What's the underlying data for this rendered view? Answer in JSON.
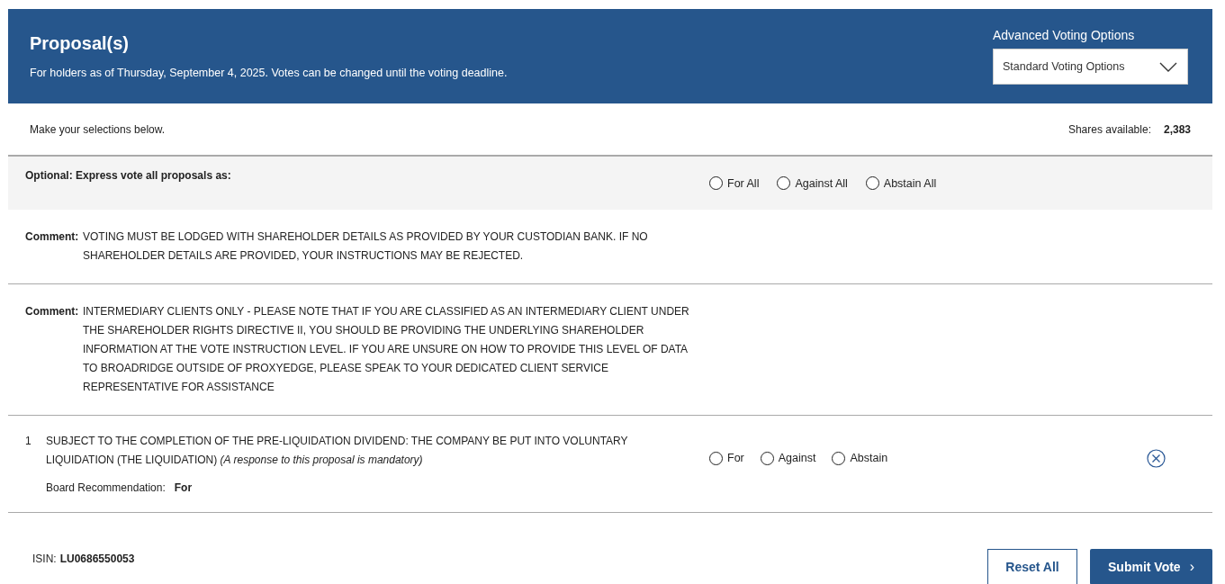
{
  "header": {
    "title": "Proposal(s)",
    "subtitle": "For holders as of Thursday, September 4, 2025. Votes can be changed until the voting deadline.",
    "options_label": "Advanced Voting Options",
    "dropdown": {
      "value": "Standard Voting Options"
    }
  },
  "intro": "Make your selections below.",
  "shares": {
    "label": "Shares available:",
    "value": "2,383"
  },
  "express_vote": {
    "label": "Optional: Express vote all proposals as:",
    "options": [
      {
        "label": "For All",
        "selected": false
      },
      {
        "label": "Against All",
        "selected": false
      },
      {
        "label": "Abstain All",
        "selected": false
      }
    ]
  },
  "comments": [
    {
      "label": "Comment:",
      "text": "VOTING MUST BE LODGED WITH SHAREHOLDER DETAILS AS PROVIDED BY YOUR CUSTODIAN BANK. IF NO SHAREHOLDER DETAILS ARE PROVIDED, YOUR INSTRUCTIONS MAY BE REJECTED."
    },
    {
      "label": "Comment:",
      "text": "INTERMEDIARY CLIENTS ONLY - PLEASE NOTE THAT IF YOU ARE CLASSIFIED AS AN INTERMEDIARY CLIENT UNDER THE SHAREHOLDER RIGHTS DIRECTIVE II, YOU SHOULD BE PROVIDING THE UNDERLYING SHAREHOLDER INFORMATION AT THE VOTE INSTRUCTION LEVEL. IF YOU ARE UNSURE ON HOW TO PROVIDE THIS LEVEL OF DATA TO BROADRIDGE OUTSIDE OF PROXYEDGE, PLEASE SPEAK TO YOUR DEDICATED CLIENT SERVICE REPRESENTATIVE FOR ASSISTANCE"
    }
  ],
  "proposals": [
    {
      "number": "1",
      "text": "SUBJECT TO THE COMPLETION OF THE PRE-LIQUIDATION DIVIDEND: THE COMPANY BE PUT INTO VOLUNTARY LIQUIDATION (THE LIQUIDATION) *(A response to this proposal is mandatory)*",
      "recommendation_label": "Board Recommendation:",
      "recommendation": "For",
      "options": [
        {
          "label": "For",
          "selected": false
        },
        {
          "label": "Against",
          "selected": false
        },
        {
          "label": "Abstain",
          "selected": false
        }
      ]
    }
  ],
  "isin": {
    "label": "ISIN:",
    "value": "LU0686550053"
  },
  "buttons": [
    {
      "label": "Reset All",
      "kind": "secondary"
    },
    {
      "label": "Submit Vote",
      "kind": "primary",
      "icon": "›"
    }
  ]
}
